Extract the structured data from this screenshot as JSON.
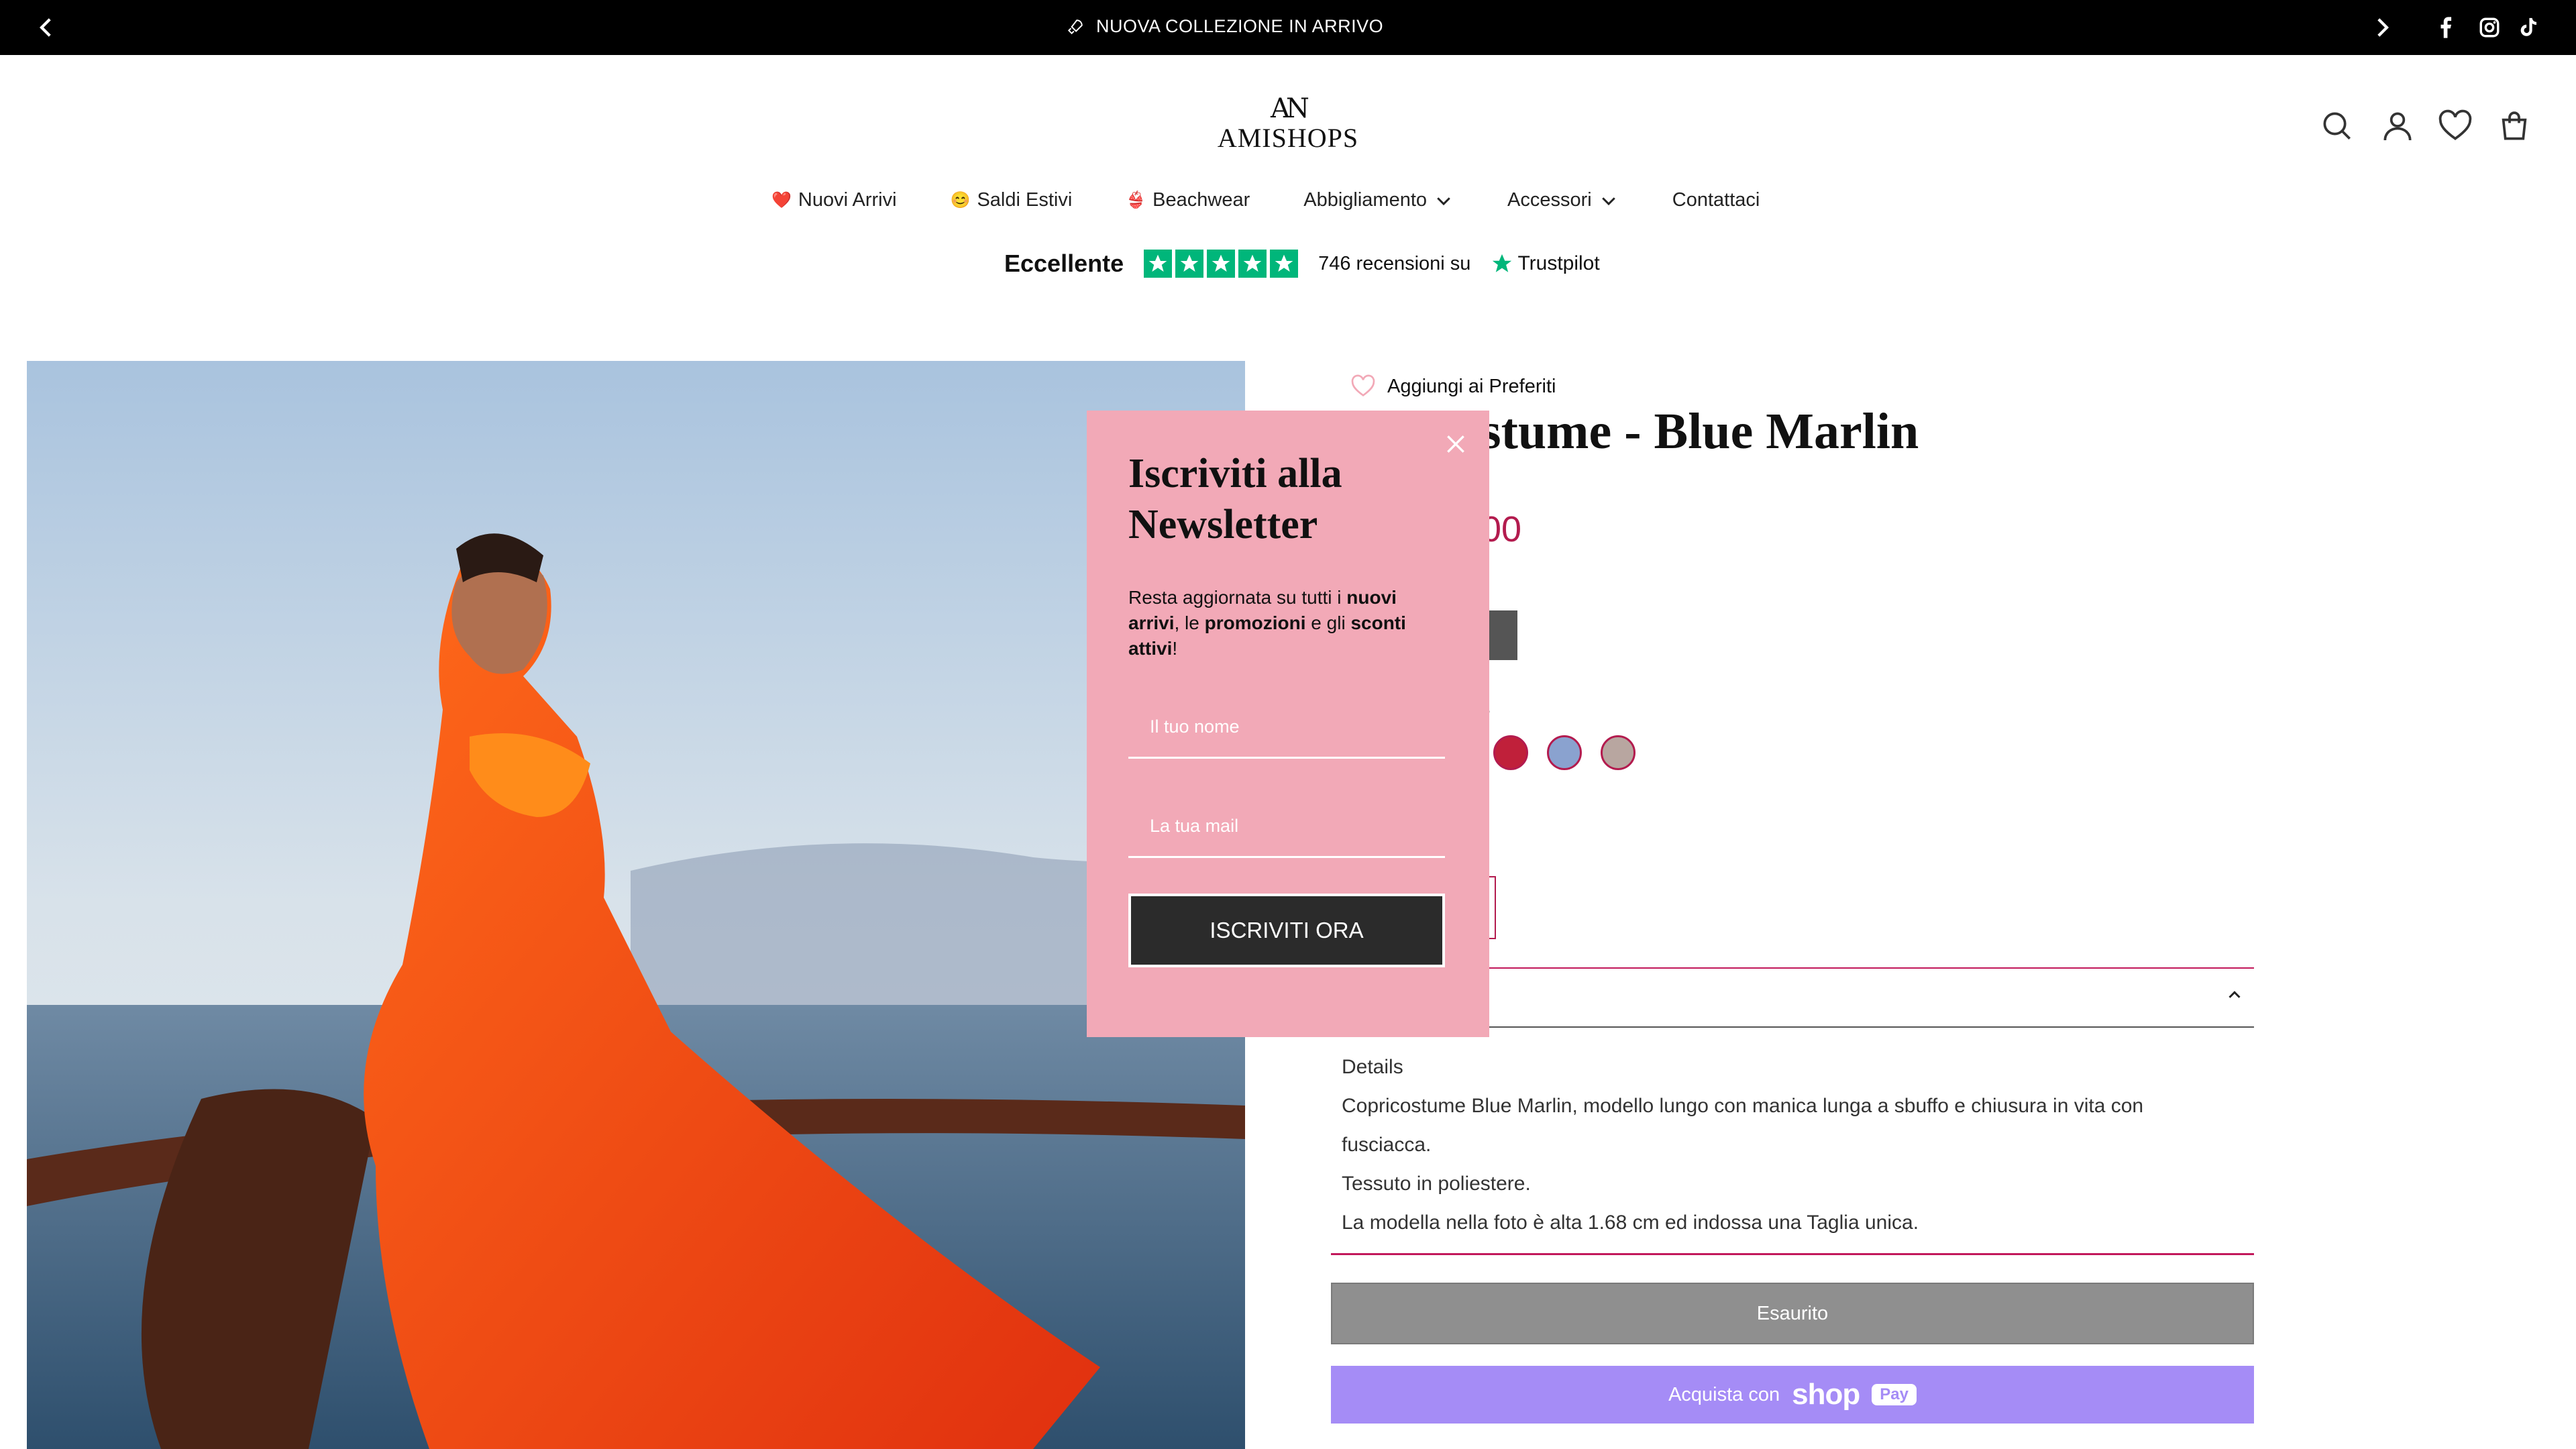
{
  "announcement": {
    "message": "NUOVA COLLEZIONE IN ARRIVO",
    "icons": [
      "chevron-left-icon",
      "rocket-icon",
      "chevron-right-icon",
      "facebook-icon",
      "instagram-icon",
      "tiktok-icon"
    ]
  },
  "header": {
    "logo_mark": "AN",
    "logo_name": "AMISHOPS",
    "icons": [
      "search-icon",
      "account-icon",
      "wishlist-icon",
      "cart-icon"
    ]
  },
  "nav": {
    "items": [
      {
        "emoji": "❤️",
        "label": "Nuovi Arrivi"
      },
      {
        "emoji": "😊",
        "label": "Saldi Estivi"
      },
      {
        "emoji": "👙",
        "label": "Beachwear"
      },
      {
        "label": "Abbigliamento",
        "dropdown": true
      },
      {
        "label": "Accessori",
        "dropdown": true
      },
      {
        "label": "Contattaci"
      }
    ]
  },
  "trustpilot": {
    "rating_word": "Eccellente",
    "stars": 5,
    "reviews": "746 recensioni su",
    "brand": "Trustpilot"
  },
  "product": {
    "wishlist_label": "Aggiungi ai Preferiti",
    "title_visible": "ostume - Blue Marlin",
    "price_visible": "00",
    "color_label_visible": "e",
    "swatches": 3,
    "accordion": {
      "lines": [
        "Details",
        "Copricostume Blue Marlin, modello lungo con manica lunga a sbuffo e chiusura in vita con",
        "fusciacca.",
        "Tessuto in poliestere.",
        "La modella nella foto è alta 1.68 cm ed indossa una Taglia unica."
      ]
    },
    "sold_out_label": "Esaurito",
    "shop_pay": {
      "prefix": "Acquista con",
      "brand": "shop",
      "badge": "Pay"
    }
  },
  "newsletter": {
    "title": "Iscriviti alla Newsletter",
    "body_parts": [
      "Resta aggiornata su tutti i ",
      "nuovi arrivi",
      ", le ",
      "promozioni",
      " e gli ",
      "sconti attivi",
      "!"
    ],
    "name_placeholder": "Il tuo nome",
    "email_placeholder": "La tua mail",
    "cta": "ISCRIVITI ORA"
  },
  "colors": {
    "accent": "#b31b4e",
    "modal_bg": "#f2a9b7",
    "shop_pay": "#a58cf6",
    "trust_green": "#00b67a"
  }
}
